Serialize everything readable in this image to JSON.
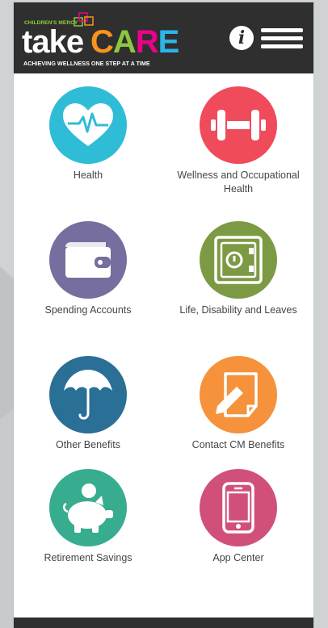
{
  "app": {
    "brand_small": "CHILDREN'S MERCY",
    "brand_take": "take",
    "brand_care": [
      "C",
      "A",
      "R",
      "E"
    ],
    "brand_care_colors": [
      "#f7941d",
      "#8dc63f",
      "#ec008c",
      "#2bb5e8"
    ],
    "tagline": "ACHIEVING WELLNESS ONE STEP AT A TIME",
    "info_icon": "i"
  },
  "tiles": [
    {
      "label": "Health",
      "color": "#2fbcd6",
      "icon": "heart-pulse-icon"
    },
    {
      "label": "Wellness and Occupational Health",
      "color": "#ef4b5b",
      "icon": "dumbbell-icon"
    },
    {
      "label": "Spending Accounts",
      "color": "#756e9e",
      "icon": "wallet-icon"
    },
    {
      "label": "Life, Disability and Leaves",
      "color": "#7c9a43",
      "icon": "safe-icon"
    },
    {
      "label": "Other Benefits",
      "color": "#2a6f95",
      "icon": "umbrella-icon"
    },
    {
      "label": "Contact CM Benefits",
      "color": "#f5923b",
      "icon": "note-pencil-icon"
    },
    {
      "label": "Retirement Savings",
      "color": "#38ac8f",
      "icon": "piggy-bank-icon"
    },
    {
      "label": "App Center",
      "color": "#d1507a",
      "icon": "smartphone-icon"
    }
  ]
}
